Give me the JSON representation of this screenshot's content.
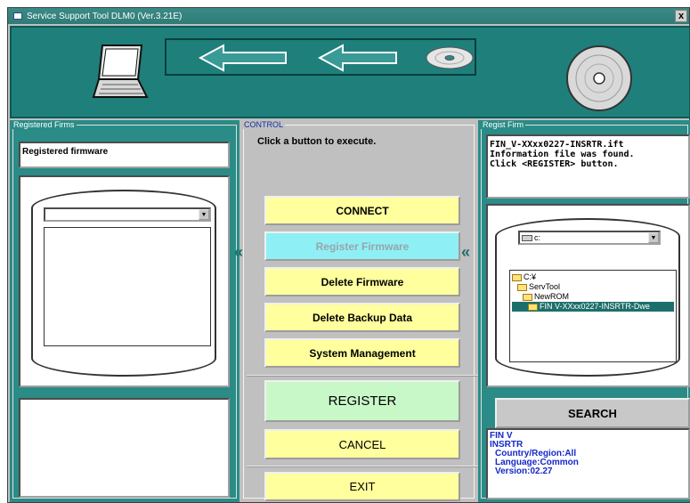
{
  "window": {
    "title": "Service Support Tool DLM0 (Ver.3.21E)",
    "close_label": "x"
  },
  "left": {
    "frame_label": "Registered Firms",
    "header_text": "Registered firmware",
    "dropdown_value": ""
  },
  "control": {
    "frame_label": "CONTROL",
    "instruction": "Click a button to execute.",
    "buttons": {
      "connect": "CONNECT",
      "register_firmware": "Register Firmware",
      "delete_firmware": "Delete Firmware",
      "delete_backup": "Delete Backup Data",
      "system_management": "System Management",
      "register": "REGISTER",
      "cancel": "CANCEL",
      "exit": "EXIT"
    },
    "chevron": "«"
  },
  "right": {
    "frame_label": "Regist Firm",
    "message": [
      "FIN_V-XXxx0227-INSRTR.ift",
      "Information file was found.",
      "Click <REGISTER> button."
    ],
    "drive_value": "c:",
    "tree": [
      "C:¥",
      "ServTool",
      "NewROM",
      "FIN V-XXxx0227-INSRTR-Dwe"
    ],
    "search_label": "SEARCH",
    "info": [
      "FIN V",
      "INSRTR",
      "Country/Region:All",
      "Language:Common",
      "Version:02.27"
    ]
  }
}
